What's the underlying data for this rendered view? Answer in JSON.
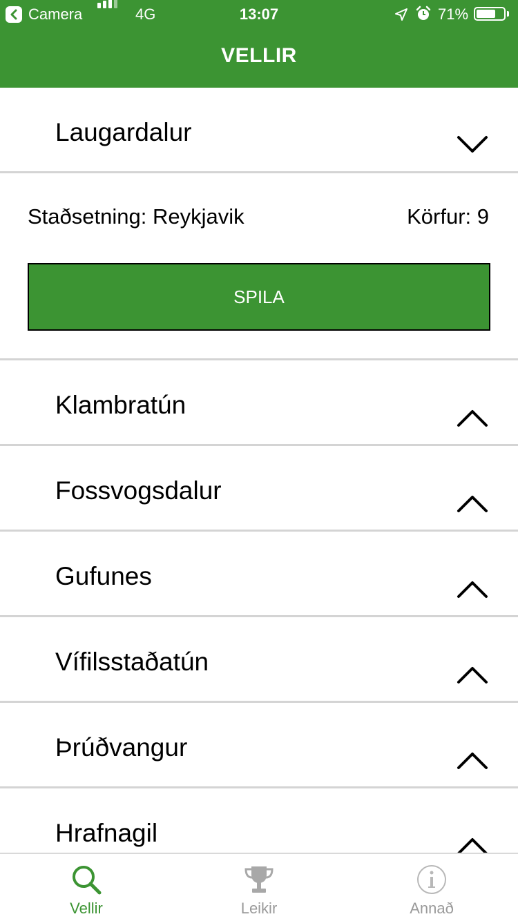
{
  "status_bar": {
    "back_app": "Camera",
    "network": "4G",
    "time": "13:07",
    "battery_percent": "71%",
    "battery_level": 0.71
  },
  "header": {
    "title": "VELLIR"
  },
  "courses": [
    {
      "name": "Laugardalur",
      "expanded": true
    },
    {
      "name": "Klambratún",
      "expanded": false
    },
    {
      "name": "Fossvogsdalur",
      "expanded": false
    },
    {
      "name": "Gufunes",
      "expanded": false
    },
    {
      "name": "Vífilsstaðatún",
      "expanded": false
    },
    {
      "name": "Þrúðvangur",
      "expanded": false
    },
    {
      "name": "Hrafnagil",
      "expanded": false
    }
  ],
  "expanded_details": {
    "location": "Staðsetning: Reykjavik",
    "baskets": "Körfur: 9",
    "play_label": "SPILA"
  },
  "tabbar": {
    "tabs": [
      {
        "label": "Vellir",
        "icon": "search-icon",
        "active": true
      },
      {
        "label": "Leikir",
        "icon": "trophy-icon",
        "active": false
      },
      {
        "label": "Annað",
        "icon": "info-icon",
        "active": false
      }
    ]
  },
  "colors": {
    "brand_green": "#3c9433",
    "divider": "#d4d4d4",
    "inactive_tab": "#9a9a9a"
  }
}
